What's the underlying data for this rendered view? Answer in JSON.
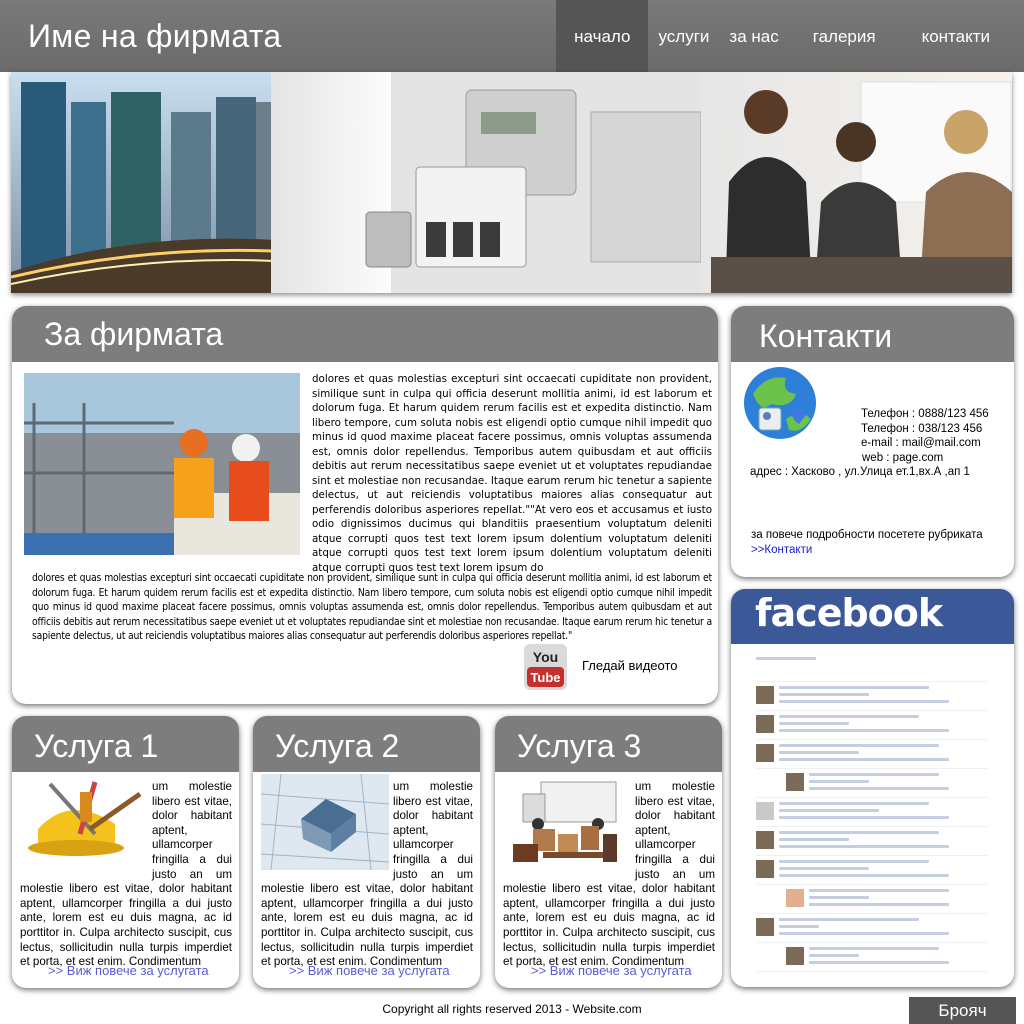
{
  "header": {
    "brand": "Име на фирмата",
    "nav": [
      "начало",
      "услуги",
      "за нас",
      "галерия",
      "контакти"
    ]
  },
  "about": {
    "title": "За фирмата",
    "text_right": "dolores et quas molestias excepturi sint occaecati cupiditate non provident, similique sunt in culpa qui officia deserunt mollitia animi, id est laborum et dolorum fuga. Et harum quidem rerum facilis est et expedita distinctio. Nam libero tempore, cum soluta nobis est eligendi optio cumque nihil impedit quo minus id quod maxime placeat facere possimus, omnis voluptas assumenda est, omnis dolor repellendus. Temporibus autem quibusdam et aut officiis debitis aut rerum necessitatibus saepe eveniet ut et voluptates repudiandae sint et molestiae non recusandae. Itaque earum rerum hic tenetur a sapiente delectus, ut aut reiciendis voluptatibus maiores alias consequatur aut perferendis doloribus asperiores repellat.\"\"At vero eos et accusamus et iusto odio dignissimos ducimus qui blanditiis praesentium voluptatum deleniti atque corrupti quos test text lorem ipsum dolentium voluptatum deleniti atque corrupti quos test text lorem ipsum dolentium voluptatum deleniti atque corrupti quos test text lorem ipsum do",
    "text_bottom": "dolores et quas molestias excepturi sint occaecati cupiditate non provident, similique sunt in culpa qui officia deserunt mollitia animi, id est laborum et dolorum fuga. Et harum quidem rerum facilis est et expedita distinctio. Nam libero tempore, cum soluta nobis est eligendi optio cumque nihil impedit quo minus id quod maxime placeat facere possimus, omnis voluptas assumenda est, omnis dolor repellendus. Temporibus autem quibusdam et aut officiis debitis aut rerum necessitatibus saepe eveniet ut et voluptates repudiandae sint et molestiae non recusandae. Itaque earum rerum hic tenetur a sapiente delectus, ut aut reiciendis voluptatibus maiores alias consequatur aut perferendis doloribus asperiores repellat.\"",
    "video_label": "Гледай видеото",
    "youtube_top": "You",
    "youtube_bottom": "Tube"
  },
  "contact": {
    "title": "Контакти",
    "lines": [
      "Телефон : 0888/123 456",
      "Телефон : 038/123 456",
      "e-mail  : mail@mail.com",
      "web : page.com"
    ],
    "address": "адрес : Хасково , ул.Улица ет.1,вх.А ,ап 1",
    "more_text": "за повече подробности посетете рубриката",
    "more_link": ">>Контакти"
  },
  "facebook": {
    "logo": "facebook"
  },
  "services": [
    {
      "title": "Услуга 1",
      "text": "um molestie libero est vitae, dolor habitant aptent, ullamcorper fringilla a dui justo an um molestie libero est vitae, dolor habitant aptent, ullamcorper fringilla a dui justo ante, lorem est eu duis magna, ac id porttitor in. Culpa architecto suscipit, cus lectus, sollicitudin nulla turpis imperdiet et porta, et est enim. Condimentum",
      "link": ">> Виж повече за услугата"
    },
    {
      "title": "Услуга 2",
      "text": "um molestie libero est vitae, dolor habitant aptent, ullamcorper fringilla a dui justo an um molestie libero est vitae, dolor habitant aptent, ullamcorper fringilla a dui justo ante, lorem est eu duis magna, ac id porttitor in. Culpa architecto suscipit, cus lectus, sollicitudin nulla turpis imperdiet et porta, et est enim. Condimentum",
      "link": ">> Виж повече за услугата"
    },
    {
      "title": "Услуга 3",
      "text": "um molestie libero est vitae, dolor habitant aptent, ullamcorper fringilla a dui justo an um molestie libero est vitae, dolor habitant aptent, ullamcorper fringilla a dui justo ante, lorem est eu duis magna, ac id porttitor in. Culpa architecto suscipit, cus lectus, sollicitudin nulla turpis imperdiet et porta, et est enim. Condimentum",
      "link": ">> Виж повече за услугата"
    }
  ],
  "footer": {
    "copyright": "Copyright all rights reserved 2013 - Website.com",
    "counter": "Брояч"
  },
  "colors": {
    "header": "#6f6f6f",
    "panel_head": "#7d7d7d",
    "facebook": "#3b5998",
    "link": "#5a5ad6"
  }
}
